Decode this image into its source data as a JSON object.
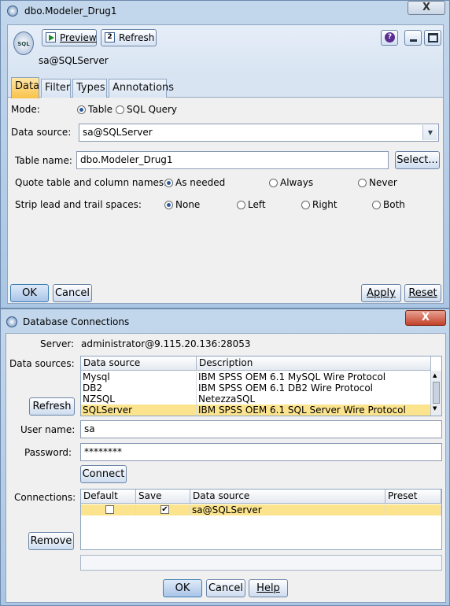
{
  "modeler": {
    "title": "dbo.Modeler_Drug1",
    "close_label": "X",
    "toolbar": {
      "preview_label": "Preview",
      "refresh_label": "Refresh"
    },
    "node_name": "sa@SQLServer",
    "tabs": [
      {
        "label": "Data",
        "active": true
      },
      {
        "label": "Filter"
      },
      {
        "label": "Types"
      },
      {
        "label": "Annotations"
      }
    ],
    "mode": {
      "label": "Mode:",
      "options": [
        "Table",
        "SQL Query"
      ],
      "selected": "Table"
    },
    "data_source": {
      "label": "Data source:",
      "value": "sa@SQLServer"
    },
    "table_name": {
      "label": "Table name:",
      "value": "dbo.Modeler_Drug1",
      "select_label": "Select..."
    },
    "quote": {
      "label": "Quote table and column names:",
      "options": [
        "As needed",
        "Always",
        "Never"
      ],
      "selected": "As needed"
    },
    "strip": {
      "label": "Strip lead and trail spaces:",
      "options": [
        "None",
        "Left",
        "Right",
        "Both"
      ],
      "selected": "None"
    },
    "buttons": {
      "ok": "OK",
      "cancel": "Cancel",
      "apply": "Apply",
      "reset": "Reset"
    }
  },
  "dbconn": {
    "title": "Database Connections",
    "close_label": "X",
    "server": {
      "label": "Server:",
      "value": "administrator@9.115.20.136:28053"
    },
    "data_sources": {
      "label": "Data sources:",
      "columns": [
        "Data source",
        "Description"
      ],
      "rows": [
        [
          "Mysql",
          "IBM SPSS OEM 6.1 MySQL Wire Protocol"
        ],
        [
          "DB2",
          "IBM SPSS OEM 6.1 DB2 Wire Protocol"
        ],
        [
          "NZSQL",
          "NetezzaSQL"
        ],
        [
          "SQLServer",
          "IBM SPSS OEM 6.1 SQL Server Wire Protocol"
        ]
      ],
      "selected_index": 3,
      "refresh_label": "Refresh"
    },
    "user_name": {
      "label": "User name:",
      "value": "sa"
    },
    "password": {
      "label": "Password:",
      "value": "********"
    },
    "connect_label": "Connect",
    "connections": {
      "label": "Connections:",
      "columns": [
        "Default",
        "Save",
        "Data source",
        "Preset"
      ],
      "rows": [
        {
          "default": false,
          "save": true,
          "data_source": "sa@SQLServer",
          "preset": ""
        }
      ],
      "remove_label": "Remove"
    },
    "buttons": {
      "ok": "OK",
      "cancel": "Cancel",
      "help": "Help"
    }
  },
  "colors": {
    "accent": "#f9c24a",
    "selection": "#fce48f",
    "title_gradient": "#aac6e4"
  }
}
